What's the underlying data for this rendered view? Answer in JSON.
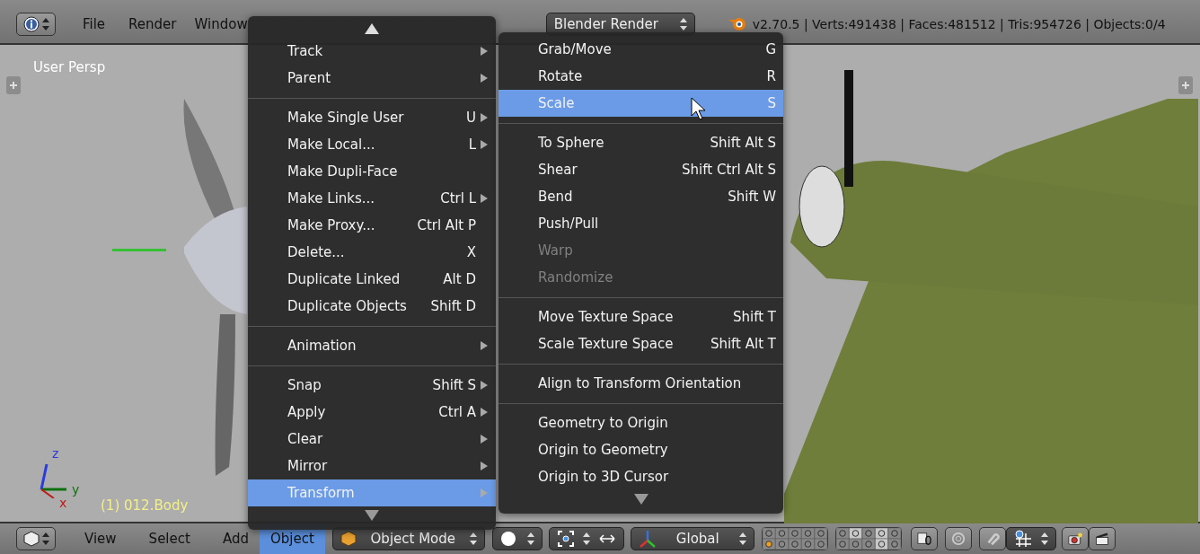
{
  "top_bar": {
    "menus": [
      {
        "label": "File"
      },
      {
        "label": "Render"
      },
      {
        "label": "Window"
      }
    ],
    "render_engine": "Blender Render",
    "stats": "v2.70.5 | Verts:491438 | Faces:481512 | Tris:954726 | Objects:0/4"
  },
  "viewport": {
    "view_name": "User Persp",
    "object_label": "(1) 012.Body",
    "axes": [
      "z",
      "y",
      "x"
    ]
  },
  "object_menu": {
    "groups": [
      [
        {
          "label": "Track",
          "submenu": true,
          "selected": false
        },
        {
          "label": "Parent",
          "submenu": true,
          "selected": false
        }
      ],
      [
        {
          "label": "Make Single User",
          "shortcut": "U",
          "submenu": true,
          "selected": false
        },
        {
          "label": "Make Local...",
          "shortcut": "L",
          "submenu": true,
          "selected": false
        },
        {
          "label": "Make Dupli-Face",
          "submenu": false,
          "selected": false
        },
        {
          "label": "Make Links...",
          "shortcut": "Ctrl L",
          "submenu": true,
          "selected": false
        },
        {
          "label": "Make Proxy...",
          "shortcut": "Ctrl Alt P",
          "submenu": false,
          "selected": false
        },
        {
          "label": "Delete...",
          "shortcut": "X",
          "submenu": false,
          "selected": false
        },
        {
          "label": "Duplicate Linked",
          "shortcut": "Alt D",
          "submenu": false,
          "selected": false
        },
        {
          "label": "Duplicate Objects",
          "shortcut": "Shift D",
          "submenu": false,
          "selected": false
        }
      ],
      [
        {
          "label": "Animation",
          "submenu": true,
          "selected": false
        }
      ],
      [
        {
          "label": "Snap",
          "shortcut": "Shift S",
          "submenu": true,
          "selected": false
        },
        {
          "label": "Apply",
          "shortcut": "Ctrl A",
          "submenu": true,
          "selected": false
        },
        {
          "label": "Clear",
          "submenu": true,
          "selected": false
        },
        {
          "label": "Mirror",
          "submenu": true,
          "selected": false
        },
        {
          "label": "Transform",
          "submenu": true,
          "selected": true
        }
      ]
    ]
  },
  "transform_menu": {
    "groups": [
      [
        {
          "label": "Grab/Move",
          "shortcut": "G",
          "disabled": false,
          "selected": false
        },
        {
          "label": "Rotate",
          "shortcut": "R",
          "disabled": false,
          "selected": false
        },
        {
          "label": "Scale",
          "shortcut": "S",
          "disabled": false,
          "selected": true
        }
      ],
      [
        {
          "label": "To Sphere",
          "shortcut": "Shift Alt S",
          "disabled": false,
          "selected": false
        },
        {
          "label": "Shear",
          "shortcut": "Shift Ctrl Alt S",
          "disabled": false,
          "selected": false
        },
        {
          "label": "Bend",
          "shortcut": "Shift W",
          "disabled": false,
          "selected": false
        },
        {
          "label": "Push/Pull",
          "disabled": false,
          "selected": false
        },
        {
          "label": "Warp",
          "disabled": true,
          "selected": false
        },
        {
          "label": "Randomize",
          "disabled": true,
          "selected": false
        }
      ],
      [
        {
          "label": "Move Texture Space",
          "shortcut": "Shift T",
          "disabled": false,
          "selected": false
        },
        {
          "label": "Scale Texture Space",
          "shortcut": "Shift Alt T",
          "disabled": false,
          "selected": false
        }
      ],
      [
        {
          "label": "Align to Transform Orientation",
          "disabled": false,
          "selected": false
        }
      ],
      [
        {
          "label": "Geometry to Origin",
          "disabled": false,
          "selected": false
        },
        {
          "label": "Origin to Geometry",
          "disabled": false,
          "selected": false
        },
        {
          "label": "Origin to 3D Cursor",
          "disabled": false,
          "selected": false
        }
      ]
    ]
  },
  "bottom_bar": {
    "menus": [
      {
        "label": "View",
        "selected": false
      },
      {
        "label": "Select",
        "selected": false
      },
      {
        "label": "Add",
        "selected": false
      },
      {
        "label": "Object",
        "selected": true
      }
    ],
    "mode": "Object Mode",
    "orientation": "Global",
    "layers": [
      {
        "selected": false,
        "active_object": false
      },
      {
        "selected": false,
        "active_object": false
      },
      {
        "selected": false,
        "active_object": false
      },
      {
        "selected": false,
        "active_object": false
      },
      {
        "selected": false,
        "active_object": false
      },
      {
        "selected": false,
        "active_object": false
      },
      {
        "selected": true,
        "active_object": false
      },
      {
        "selected": false,
        "active_object": false
      },
      {
        "selected": true,
        "active_object": false
      },
      {
        "selected": false,
        "active_object": false
      },
      {
        "selected": false,
        "active_object": true
      },
      {
        "selected": false,
        "active_object": false
      },
      {
        "selected": false,
        "active_object": false
      },
      {
        "selected": false,
        "active_object": false
      },
      {
        "selected": false,
        "active_object": false
      },
      {
        "selected": false,
        "active_object": false
      },
      {
        "selected": false,
        "active_object": false
      },
      {
        "selected": false,
        "active_object": false
      },
      {
        "selected": true,
        "active_object": false
      },
      {
        "selected": false,
        "active_object": false
      }
    ]
  }
}
